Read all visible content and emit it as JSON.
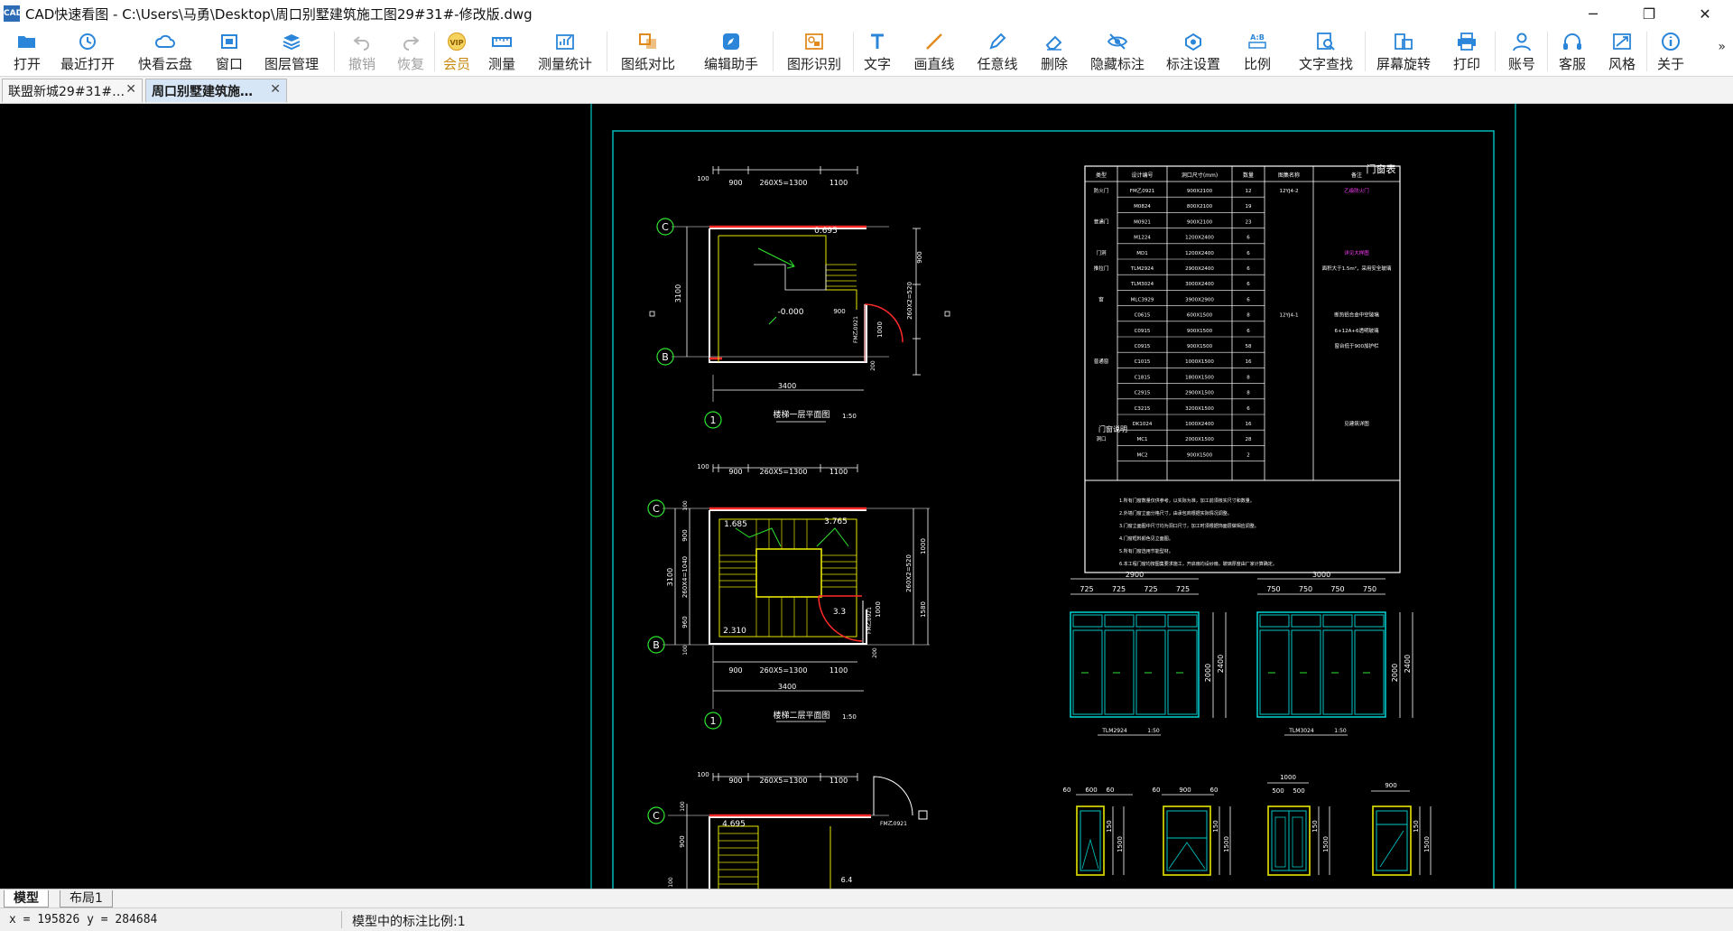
{
  "window": {
    "logo_text": "CAD",
    "title": "CAD快速看图 - C:\\Users\\马勇\\Desktop\\周口别墅建筑施工图29#31#-修改版.dwg",
    "minimize": "─",
    "restore": "❐",
    "close": "✕"
  },
  "toolbar": {
    "items": [
      {
        "label": "打开",
        "icon": "folder-open-icon",
        "state": "normal"
      },
      {
        "label": "最近打开",
        "icon": "clock-history-icon",
        "state": "normal"
      },
      {
        "label": "快看云盘",
        "icon": "cloud-icon",
        "state": "normal"
      },
      {
        "label": "窗口",
        "icon": "window-icon",
        "state": "normal"
      },
      {
        "label": "图层管理",
        "icon": "layers-icon",
        "state": "normal"
      },
      {
        "label": "撤销",
        "icon": "undo-icon",
        "state": "disabled"
      },
      {
        "label": "恢复",
        "icon": "redo-icon",
        "state": "disabled"
      },
      {
        "label": "会员",
        "icon": "vip-icon",
        "state": "vip",
        "badge": "VIP"
      },
      {
        "label": "测量",
        "icon": "ruler-icon",
        "state": "normal"
      },
      {
        "label": "测量统计",
        "icon": "measure-stats-icon",
        "state": "normal"
      },
      {
        "label": "图纸对比",
        "icon": "compare-icon",
        "state": "normal"
      },
      {
        "label": "编辑助手",
        "icon": "edit-assistant-icon",
        "state": "normal"
      },
      {
        "label": "图形识别",
        "icon": "shape-recognition-icon",
        "state": "normal"
      },
      {
        "label": "文字",
        "icon": "text-icon",
        "state": "normal"
      },
      {
        "label": "画直线",
        "icon": "line-icon",
        "state": "normal"
      },
      {
        "label": "任意线",
        "icon": "pencil-icon",
        "state": "normal"
      },
      {
        "label": "删除",
        "icon": "eraser-icon",
        "state": "normal"
      },
      {
        "label": "隐藏标注",
        "icon": "eye-hide-icon",
        "state": "normal"
      },
      {
        "label": "标注设置",
        "icon": "annotation-settings-icon",
        "state": "normal"
      },
      {
        "label": "比例",
        "icon": "scale-ratio-icon",
        "state": "normal"
      },
      {
        "label": "文字查找",
        "icon": "text-search-icon",
        "state": "normal"
      },
      {
        "label": "屏幕旋转",
        "icon": "rotate-screen-icon",
        "state": "normal"
      },
      {
        "label": "打印",
        "icon": "printer-icon",
        "state": "normal"
      },
      {
        "label": "账号",
        "icon": "user-icon",
        "state": "normal"
      },
      {
        "label": "客服",
        "icon": "headset-icon",
        "state": "normal"
      },
      {
        "label": "风格",
        "icon": "style-icon",
        "state": "normal"
      },
      {
        "label": "关于",
        "icon": "info-icon",
        "state": "normal"
      }
    ],
    "more": "»",
    "colors": {
      "icon_blue": "#2b86d9",
      "disabled": "#b5b5b5",
      "vip": "#d99a1b"
    }
  },
  "doc_tabs": [
    {
      "label": "联盟新城29#31#…",
      "active": false,
      "close": "✕"
    },
    {
      "label": "周口别墅建筑施…",
      "active": true,
      "close": "✕"
    }
  ],
  "drawing": {
    "colors": {
      "cyan": "#00c8c8",
      "green": "#2ee62e",
      "white": "#ffffff",
      "yellow": "#e6e600",
      "red": "#ff2a2a",
      "magenta": "#ff3cff",
      "background": "#000000"
    },
    "plan1": {
      "dims_top": [
        "100",
        "900",
        "260X5=1300",
        "1100"
      ],
      "axis_c": "C",
      "axis_b": "B",
      "axis_1": "1",
      "left_dim": "3100",
      "right_dim": "260X2=520",
      "right_dim_b": "900",
      "bottom_dim": "3400",
      "elev_a": "0.695",
      "elev_b": "-0.000",
      "door_w": "900",
      "door_h": "1000",
      "door_code": "FM乙0921",
      "door_small": "200",
      "caption": "楼梯一层平面图",
      "scale": "1:50"
    },
    "plan2": {
      "dims_top": [
        "100",
        "900",
        "260X5=1300",
        "1100"
      ],
      "dims_bottom": [
        "900",
        "260X5=1300",
        "1100"
      ],
      "axis_c": "C",
      "axis_b": "B",
      "axis_1": "1",
      "left_dim": "3100",
      "left_dims": [
        "100",
        "900",
        "260X4=1040",
        "960",
        "100"
      ],
      "right_dims": [
        "1000",
        "260X2=520",
        "1580",
        "200"
      ],
      "bottom_dim": "3400",
      "elev_a": "1.685",
      "elev_b": "3.765",
      "elev_c": "2.310",
      "elev_d": "3.3",
      "door_h": "1000",
      "door_code": "FM乙0921",
      "caption": "楼梯二层平面图",
      "scale": "1:50"
    },
    "plan3": {
      "dims_top": [
        "100",
        "900",
        "260X5=1300",
        "1100"
      ],
      "axis_c": "C",
      "elev_a": "4.695",
      "elev_b": "6.4",
      "left_dims": [
        "100",
        "900",
        "100"
      ],
      "door_code": "FM乙0921"
    },
    "door_table": {
      "title": "门窗表",
      "headers": [
        "类型",
        "设计编号",
        "洞口尺寸(mm)",
        "数量",
        "图集名称",
        "备注"
      ],
      "rows": [
        [
          "防火门",
          "FM乙0921",
          "900X2100",
          "12",
          "12YJ4-2",
          "乙级防火门"
        ],
        [
          "",
          "M0824",
          "800X2100",
          "19",
          "",
          ""
        ],
        [
          "普通门",
          "M0921",
          "900X2100",
          "23",
          "",
          ""
        ],
        [
          "",
          "M1224",
          "1200X2400",
          "6",
          "",
          ""
        ],
        [
          "门洞",
          "MD1",
          "1200X2400",
          "6",
          "",
          "详见大样图"
        ],
        [
          "推拉门",
          "TLM2924",
          "2900X2400",
          "6",
          "",
          "面积大于1.5m²，采用安全玻璃"
        ],
        [
          "",
          "TLM3024",
          "3000X2400",
          "6",
          "",
          ""
        ],
        [
          "窗",
          "MLC3929",
          "3900X2900",
          "6",
          "",
          ""
        ],
        [
          "",
          "C0615",
          "600X1500",
          "8",
          "12YJ4-1",
          "断热铝合金中空玻璃"
        ],
        [
          "",
          "C0915",
          "900X1500",
          "6",
          "",
          "6+12A+6透明玻璃"
        ],
        [
          "",
          "C0915",
          "900X1500",
          "58",
          "",
          "窗台低于900加护栏"
        ],
        [
          "普通窗",
          "C1015",
          "1000X1500",
          "16",
          "",
          ""
        ],
        [
          "",
          "C1815",
          "1800X1500",
          "8",
          "",
          ""
        ],
        [
          "",
          "C2915",
          "2900X1500",
          "8",
          "",
          ""
        ],
        [
          "",
          "C3215",
          "3200X1500",
          "6",
          "",
          ""
        ],
        [
          "",
          "DK1024",
          "1000X2400",
          "16",
          "",
          "见建筑详图"
        ],
        [
          "洞口",
          "MC1",
          "2000X1500",
          "28",
          "",
          ""
        ],
        [
          "",
          "MC2",
          "900X1500",
          "2",
          "",
          ""
        ]
      ],
      "notes_title": "门窗说明",
      "notes": [
        "1.所有门窗数量仅供参考，以实际为准，加工前须核实尺寸和数量。",
        "2.外墙门窗立面分格尺寸，由承包商根据实际情况调整。",
        "3.门窗立面图中尺寸均为洞口尺寸，加工时须根据饰面层做相应调整。",
        "4.门窗框料颜色见立面图。",
        "5.所有门窗选用节能型材。",
        "6.本工程门窗均按图集要求施工，开启扇均设纱扇，玻璃厚度由厂家计算确定。"
      ]
    },
    "elevations": {
      "tlm2924": {
        "overall": "2900",
        "panels": [
          "725",
          "725",
          "725",
          "725"
        ],
        "h1": "2000",
        "h2": "2400",
        "label": "TLM2924",
        "scale": "1:50"
      },
      "tlm3024": {
        "overall": "3000",
        "panels": [
          "750",
          "750",
          "750",
          "750"
        ],
        "h1": "2000",
        "h2": "2400",
        "label": "TLM3024",
        "scale": "1:50"
      },
      "c0615": {
        "dims": [
          "60",
          "600",
          "60"
        ],
        "h1": "150",
        "h2": "1500"
      },
      "c0915": {
        "dims": [
          "60",
          "900",
          "60"
        ],
        "h1": "150",
        "h2": "1500"
      },
      "c1015": {
        "overall": "1000",
        "dims": [
          "500",
          "500"
        ],
        "h1": "150",
        "h2": "1500"
      },
      "mc2": {
        "overall": "900",
        "h1": "150",
        "h2": "1500"
      }
    }
  },
  "layout_tabs": [
    {
      "label": "模型",
      "active": true
    },
    {
      "label": "布局1",
      "active": false
    }
  ],
  "status": {
    "coords": "x = 195826 y = 284684",
    "scale_text": "模型中的标注比例:1"
  }
}
